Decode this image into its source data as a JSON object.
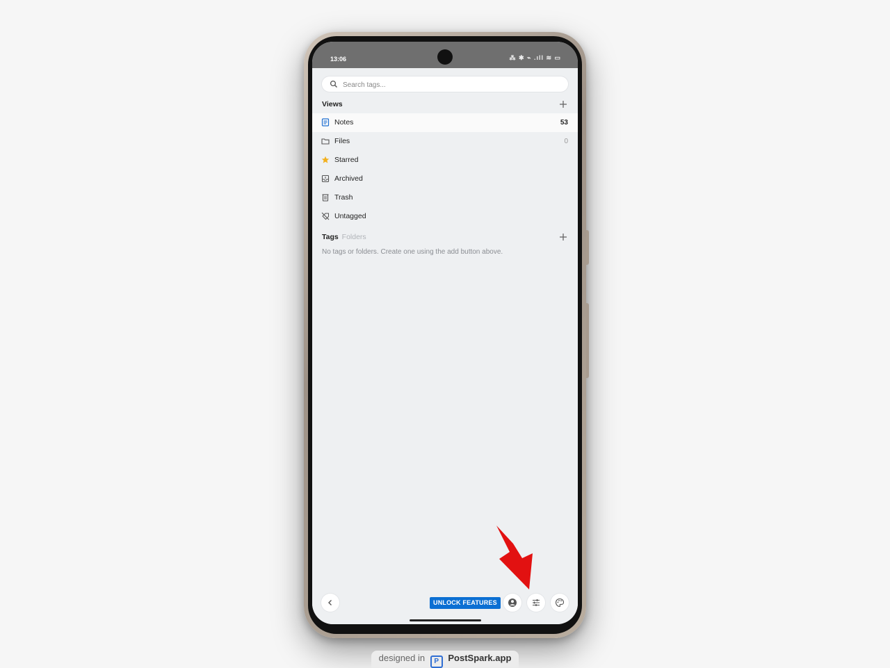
{
  "status_bar": {
    "time": "13:06",
    "icons_text": "⁂ ✱ ⌁ .ıll ≋ ▭"
  },
  "search": {
    "placeholder": "Search tags..."
  },
  "views": {
    "title": "Views",
    "items": [
      {
        "label": "Notes",
        "count": "53",
        "icon": "notes-icon",
        "selected": true
      },
      {
        "label": "Files",
        "count": "0",
        "icon": "folder-icon",
        "selected": false
      },
      {
        "label": "Starred",
        "count": "",
        "icon": "star-icon",
        "selected": false
      },
      {
        "label": "Archived",
        "count": "",
        "icon": "archive-icon",
        "selected": false
      },
      {
        "label": "Trash",
        "count": "",
        "icon": "trash-icon",
        "selected": false
      },
      {
        "label": "Untagged",
        "count": "",
        "icon": "untagged-icon",
        "selected": false
      }
    ]
  },
  "tags": {
    "title": "Tags",
    "subtitle": "Folders",
    "empty_message": "No tags or folders. Create one using the add button above."
  },
  "bottom_bar": {
    "unlock_label": "UNLOCK FEATURES"
  },
  "watermark": {
    "prefix": "designed in",
    "brand": "PostSpark.app"
  },
  "colors": {
    "accent": "#0b6fd3",
    "star": "#f2b01e",
    "arrow": "#e21111",
    "status_bar": "#6f6f6f"
  }
}
